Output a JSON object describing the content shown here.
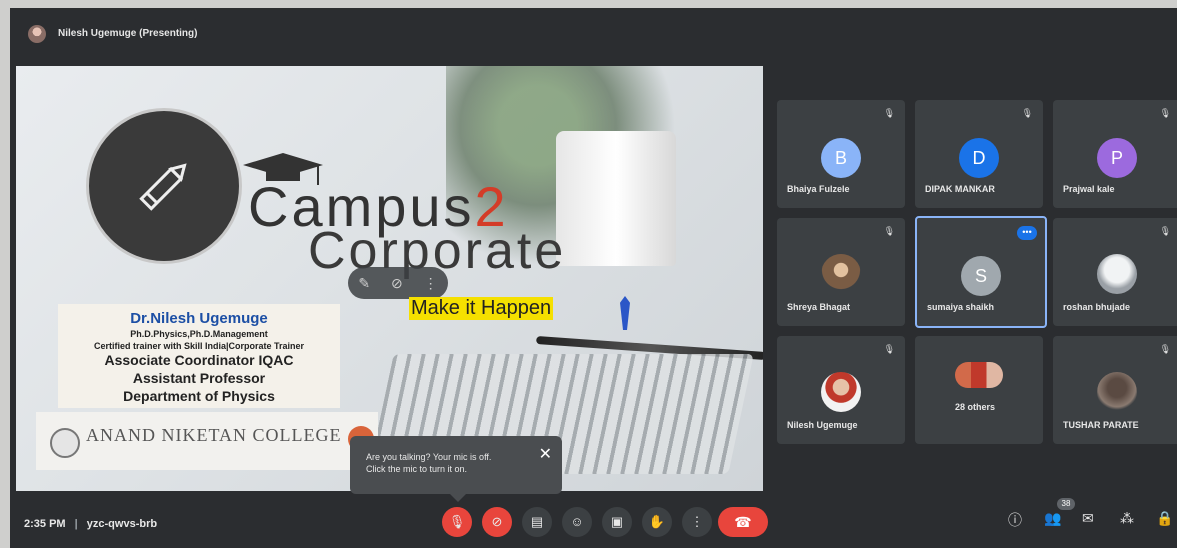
{
  "header": {
    "presenter": "Nilesh Ugemuge (Presenting)"
  },
  "slide": {
    "brand_line1_a": "Campus",
    "brand_line1_b": "2",
    "brand_line2": "Corporate",
    "tagline": "Make it Happen",
    "bio": {
      "name": "Dr.Nilesh Ugemuge",
      "degrees": "Ph.D.Physics,Ph.D.Management",
      "trainer": "Certified trainer with Skill India|Corporate Trainer",
      "role1": "Associate Coordinator IQAC",
      "role2": "Assistant Professor",
      "role3": "Department of Physics"
    },
    "college": "ANAND NIKETAN COLLEGE"
  },
  "tooltip": {
    "line1": "Are you talking? Your mic is off.",
    "line2": "Click the mic to turn it on."
  },
  "participants": [
    {
      "name": "Bhaiya Fulzele",
      "initial": "B",
      "color": "#8ab4f8"
    },
    {
      "name": "DIPAK MANKAR",
      "initial": "D",
      "color": "#1a73e8"
    },
    {
      "name": "Prajwal kale",
      "initial": "P",
      "color": "#9c6ade"
    },
    {
      "name": "Shreya Bhagat",
      "initial": "",
      "color": "#7a5c44"
    },
    {
      "name": "sumaiya shaikh",
      "initial": "S",
      "color": "#a0a8ae"
    },
    {
      "name": "roshan bhujade",
      "initial": "",
      "color": "#c9d1d6"
    },
    {
      "name": "Nilesh Ugemuge",
      "initial": "",
      "color": "#e8e0d8"
    },
    {
      "name": "28 others",
      "initial": "",
      "color": "#d26a4a"
    },
    {
      "name": "TUSHAR PARATE",
      "initial": "",
      "color": "#6b5b52"
    }
  ],
  "bottom": {
    "time": "2:35 PM",
    "separator": "|",
    "meeting_code": "yzc-qwvs-brb",
    "people_count": "38"
  },
  "colors": {
    "accent": "#d43c28",
    "danger": "#e8453c",
    "active_border": "#8ab4f8"
  }
}
